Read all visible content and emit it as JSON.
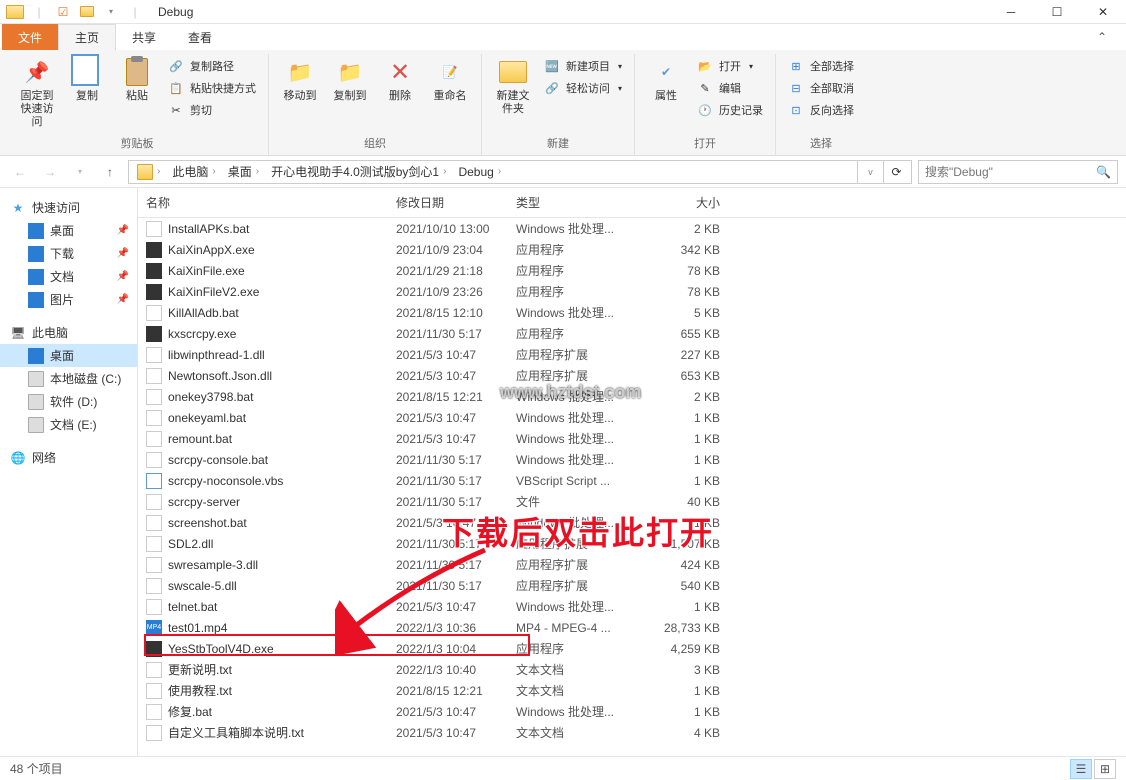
{
  "window": {
    "title": "Debug"
  },
  "tabs": {
    "file": "文件",
    "home": "主页",
    "share": "共享",
    "view": "查看"
  },
  "ribbon": {
    "pin": "固定到快速访问",
    "copy": "复制",
    "paste": "粘贴",
    "copy_path": "复制路径",
    "paste_shortcut": "粘贴快捷方式",
    "cut": "剪切",
    "clipboard_group": "剪贴板",
    "move_to": "移动到",
    "copy_to": "复制到",
    "delete": "删除",
    "rename": "重命名",
    "organize_group": "组织",
    "new_folder": "新建文件夹",
    "new_item": "新建项目",
    "easy_access": "轻松访问",
    "new_group": "新建",
    "properties": "属性",
    "open": "打开",
    "edit": "编辑",
    "history": "历史记录",
    "open_group": "打开",
    "select_all": "全部选择",
    "select_none": "全部取消",
    "invert_selection": "反向选择",
    "select_group": "选择"
  },
  "breadcrumb": {
    "items": [
      "此电脑",
      "桌面",
      "开心电视助手4.0测试版by剑心1",
      "Debug"
    ],
    "refresh_dropdown": "v"
  },
  "search": {
    "placeholder": "搜索\"Debug\""
  },
  "sidebar": {
    "quick_access": "快速访问",
    "desktop": "桌面",
    "downloads": "下载",
    "documents": "文档",
    "pictures": "图片",
    "this_pc": "此电脑",
    "pc_desktop": "桌面",
    "local_disk": "本地磁盘 (C:)",
    "software": "软件 (D:)",
    "docs_e": "文档 (E:)",
    "network": "网络"
  },
  "columns": {
    "name": "名称",
    "date": "修改日期",
    "type": "类型",
    "size": "大小"
  },
  "files": [
    {
      "name": "InstallAPKs.bat",
      "date": "2021/10/10 13:00",
      "type": "Windows 批处理...",
      "size": "2 KB",
      "ico": "bat"
    },
    {
      "name": "KaiXinAppX.exe",
      "date": "2021/10/9 23:04",
      "type": "应用程序",
      "size": "342 KB",
      "ico": "exe"
    },
    {
      "name": "KaiXinFile.exe",
      "date": "2021/1/29 21:18",
      "type": "应用程序",
      "size": "78 KB",
      "ico": "exe"
    },
    {
      "name": "KaiXinFileV2.exe",
      "date": "2021/10/9 23:26",
      "type": "应用程序",
      "size": "78 KB",
      "ico": "exe"
    },
    {
      "name": "KillAllAdb.bat",
      "date": "2021/8/15 12:10",
      "type": "Windows 批处理...",
      "size": "5 KB",
      "ico": "bat"
    },
    {
      "name": "kxscrcpy.exe",
      "date": "2021/11/30 5:17",
      "type": "应用程序",
      "size": "655 KB",
      "ico": "exe"
    },
    {
      "name": "libwinpthread-1.dll",
      "date": "2021/5/3 10:47",
      "type": "应用程序扩展",
      "size": "227 KB",
      "ico": "dll"
    },
    {
      "name": "Newtonsoft.Json.dll",
      "date": "2021/5/3 10:47",
      "type": "应用程序扩展",
      "size": "653 KB",
      "ico": "dll"
    },
    {
      "name": "onekey3798.bat",
      "date": "2021/8/15 12:21",
      "type": "Windows 批处理...",
      "size": "2 KB",
      "ico": "bat"
    },
    {
      "name": "onekeyaml.bat",
      "date": "2021/5/3 10:47",
      "type": "Windows 批处理...",
      "size": "1 KB",
      "ico": "bat"
    },
    {
      "name": "remount.bat",
      "date": "2021/5/3 10:47",
      "type": "Windows 批处理...",
      "size": "1 KB",
      "ico": "bat"
    },
    {
      "name": "scrcpy-console.bat",
      "date": "2021/11/30 5:17",
      "type": "Windows 批处理...",
      "size": "1 KB",
      "ico": "bat"
    },
    {
      "name": "scrcpy-noconsole.vbs",
      "date": "2021/11/30 5:17",
      "type": "VBScript Script ...",
      "size": "1 KB",
      "ico": "vbs"
    },
    {
      "name": "scrcpy-server",
      "date": "2021/11/30 5:17",
      "type": "文件",
      "size": "40 KB",
      "ico": "blank"
    },
    {
      "name": "screenshot.bat",
      "date": "2021/5/3 10:47",
      "type": "Windows 批处理...",
      "size": "1 KB",
      "ico": "bat"
    },
    {
      "name": "SDL2.dll",
      "date": "2021/11/30 5:17",
      "type": "应用程序扩展",
      "size": "1,507 KB",
      "ico": "dll"
    },
    {
      "name": "swresample-3.dll",
      "date": "2021/11/30 5:17",
      "type": "应用程序扩展",
      "size": "424 KB",
      "ico": "dll"
    },
    {
      "name": "swscale-5.dll",
      "date": "2021/11/30 5:17",
      "type": "应用程序扩展",
      "size": "540 KB",
      "ico": "dll"
    },
    {
      "name": "telnet.bat",
      "date": "2021/5/3 10:47",
      "type": "Windows 批处理...",
      "size": "1 KB",
      "ico": "bat"
    },
    {
      "name": "test01.mp4",
      "date": "2022/1/3 10:36",
      "type": "MP4 - MPEG-4 ...",
      "size": "28,733 KB",
      "ico": "mp4"
    },
    {
      "name": "YesStbToolV4D.exe",
      "date": "2022/1/3 10:04",
      "type": "应用程序",
      "size": "4,259 KB",
      "ico": "exe"
    },
    {
      "name": "更新说明.txt",
      "date": "2022/1/3 10:40",
      "type": "文本文档",
      "size": "3 KB",
      "ico": "txt"
    },
    {
      "name": "使用教程.txt",
      "date": "2021/8/15 12:21",
      "type": "文本文档",
      "size": "1 KB",
      "ico": "txt"
    },
    {
      "name": "修复.bat",
      "date": "2021/5/3 10:47",
      "type": "Windows 批处理...",
      "size": "1 KB",
      "ico": "bat"
    },
    {
      "name": "自定义工具箱脚本说明.txt",
      "date": "2021/5/3 10:47",
      "type": "文本文档",
      "size": "4 KB",
      "ico": "txt"
    }
  ],
  "status": {
    "count": "48 个项目"
  },
  "annotation": {
    "text": "下载后双击此打开",
    "watermark": "www.hztdst.com"
  }
}
